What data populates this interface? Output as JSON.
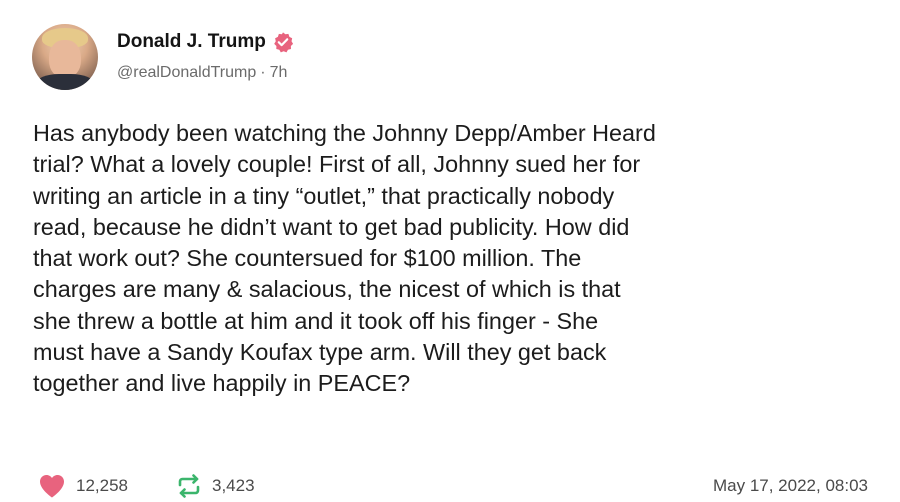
{
  "post": {
    "author": {
      "display_name": "Donald J. Trump",
      "handle": "@realDonaldTrump",
      "separator": "·",
      "relative_time": "7h",
      "verified_icon": "verified-badge-icon"
    },
    "body": "Has anybody been watching the Johnny Depp/Amber Heard\ntrial? What a lovely couple! First of all, Johnny sued her for\nwriting an article in a tiny “outlet,” that practically nobody\nread, because he didn’t want to get bad publicity. How did\nthat work out? She countersued for $100 million. The\ncharges are many & salacious, the nicest of which is that\nshe threw a bottle at him and it took off his finger - She\nmust have a Sandy Koufax type arm. Will they get back\ntogether and live happily in PEACE?",
    "stats": {
      "likes": "12,258",
      "reposts": "3,423"
    },
    "timestamp": "May 17, 2022, 08:03"
  },
  "colors": {
    "like_heart": "#e8637e",
    "repost_icon": "#3bb56c",
    "verified_badge": "#e8637e",
    "muted_text": "#6b6b6b"
  },
  "icons": {
    "like": "heart-icon",
    "repost": "repost-arrows-icon"
  }
}
